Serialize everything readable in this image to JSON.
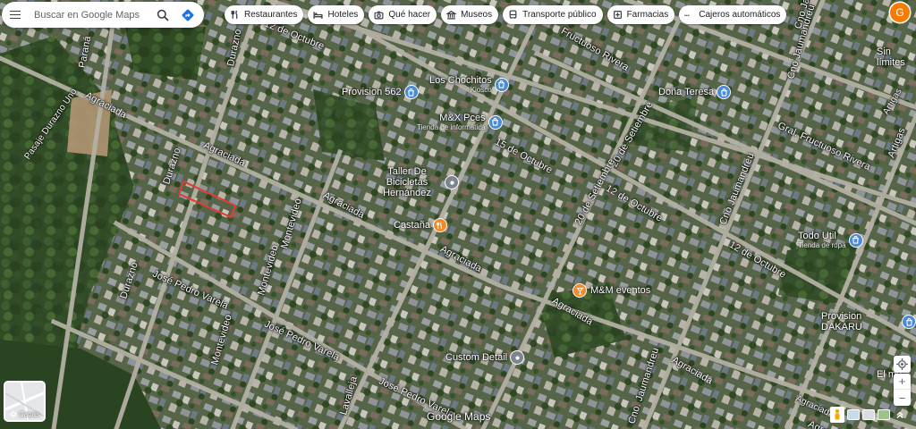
{
  "search": {
    "placeholder": "Buscar en Google Maps"
  },
  "chips": [
    {
      "label": "Restaurantes",
      "icon": "fork-knife-icon"
    },
    {
      "label": "Hoteles",
      "icon": "bed-icon"
    },
    {
      "label": "Qué hacer",
      "icon": "camera-icon"
    },
    {
      "label": "Museos",
      "icon": "museum-icon"
    },
    {
      "label": "Transporte público",
      "icon": "bus-icon"
    },
    {
      "label": "Farmacias",
      "icon": "pharmacy-icon"
    },
    {
      "label": "Cajeros automáticos",
      "icon": "atm-icon"
    }
  ],
  "account": {
    "initial": "G",
    "color": "#f57c00"
  },
  "pois": [
    {
      "name": "Provision 562",
      "sub": "",
      "icon": "shopping-bag-icon",
      "color": "#4a8cd6"
    },
    {
      "name": "Los Chochitos",
      "sub": "Kiosco",
      "icon": "shopping-bag-icon",
      "color": "#4a8cd6"
    },
    {
      "name": "M&X Pces",
      "sub": "Tienda de informática",
      "icon": "shopping-bag-icon",
      "color": "#4a8cd6"
    },
    {
      "name": "Doña Teresa",
      "sub": "",
      "icon": "shopping-bag-icon",
      "color": "#4a8cd6"
    },
    {
      "name": "Taller De Bicicletas Hernández",
      "sub": "",
      "icon": "service-icon",
      "color": "#7c8590"
    },
    {
      "name": "Castaña",
      "sub": "",
      "icon": "restaurant-icon",
      "color": "#f08a2c"
    },
    {
      "name": "M&M eventos",
      "sub": "",
      "icon": "drink-icon",
      "color": "#f08a2c"
    },
    {
      "name": "Todo Util",
      "sub": "Tienda de ropa",
      "icon": "shopping-bag-icon",
      "color": "#4a8cd6"
    },
    {
      "name": "Provision DAKARU",
      "sub": "",
      "icon": "shopping-bag-icon",
      "color": "#4a8cd6"
    },
    {
      "name": "Custom Detail",
      "sub": "",
      "icon": "service-icon",
      "color": "#7c8590"
    },
    {
      "name": "Sin límites",
      "sub": "",
      "icon": "",
      "color": ""
    },
    {
      "name": "El me",
      "sub": "",
      "icon": "",
      "color": ""
    }
  ],
  "streets": [
    "Paraná",
    "Durazno",
    "12 de Octubre",
    "Agraciada",
    "Pasaje Durazno Uno",
    "Agraciada",
    "Durazno",
    "Agraciada",
    "Montevideo",
    "Agraciada",
    "Durazno",
    "José Pedro Varela",
    "Montevideo",
    "Montevideo",
    "José Pedro Varela",
    "José Pedro Varela",
    "Lavalleja",
    "15 de Octubre",
    "20 de Setiembre",
    "Fructuoso Rivera",
    "12 de Octubre",
    "20 de Setiembre",
    "Cno Jaumandreu",
    "Gral. Fructuoso Rivera",
    "Artigas",
    "12 de Octubre",
    "Agraciada",
    "Agraciada",
    "Cno Jaumandreu",
    "Agraciada",
    "Cno Jaumandreu",
    "Cno. Jaumandreu",
    "Artigas",
    "Agraciada"
  ],
  "layers": {
    "label": "Capas"
  },
  "zoom": {
    "in": "+",
    "out": "−"
  },
  "branding": {
    "logo": "Google Maps"
  },
  "selection": {
    "color": "#e53935"
  }
}
